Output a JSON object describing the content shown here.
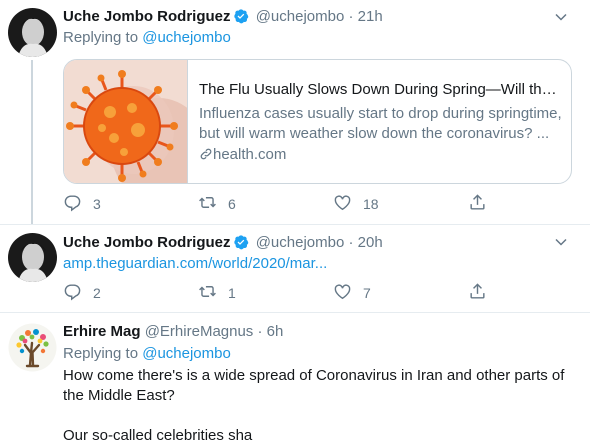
{
  "tweets": [
    {
      "name": "Uche Jombo Rodriguez",
      "handle": "@uchejombo",
      "dot": "·",
      "time": "21h",
      "replying_prefix": "Replying to",
      "replying_handle": "@uchejombo",
      "card": {
        "title": "The Flu Usually Slows Down During Spring—Will the ...",
        "description_line1": "Influenza cases usually start to drop during springtime,",
        "description_line2": "but will warm weather slow down the coronavirus? ...",
        "domain": "health.com"
      },
      "actions": {
        "replies": "3",
        "retweets": "6",
        "likes": "18"
      }
    },
    {
      "name": "Uche Jombo Rodriguez",
      "handle": "@uchejombo",
      "dot": "·",
      "time": "20h",
      "link": "amp.theguardian.com/world/2020/mar...",
      "actions": {
        "replies": "2",
        "retweets": "1",
        "likes": "7"
      }
    },
    {
      "name": "Erhire Mag",
      "handle": "@ErhireMagnus",
      "dot": "·",
      "time": "6h",
      "replying_prefix": "Replying to",
      "replying_handle": "@uchejombo",
      "text_line1": "How come there's is a wide spread of Coronavirus in Iran and other parts of",
      "text_line2": "the Middle East?",
      "text_line3": "Our so-called celebrities sha"
    }
  ],
  "colors": {
    "accent": "#1b95e0",
    "secondary": "#657786",
    "border": "#e6ecf0",
    "verified": "#1da1f2"
  },
  "icons": [
    "verified-badge-icon",
    "chevron-down-icon",
    "reply-icon",
    "retweet-icon",
    "like-icon",
    "share-icon",
    "link-icon"
  ]
}
